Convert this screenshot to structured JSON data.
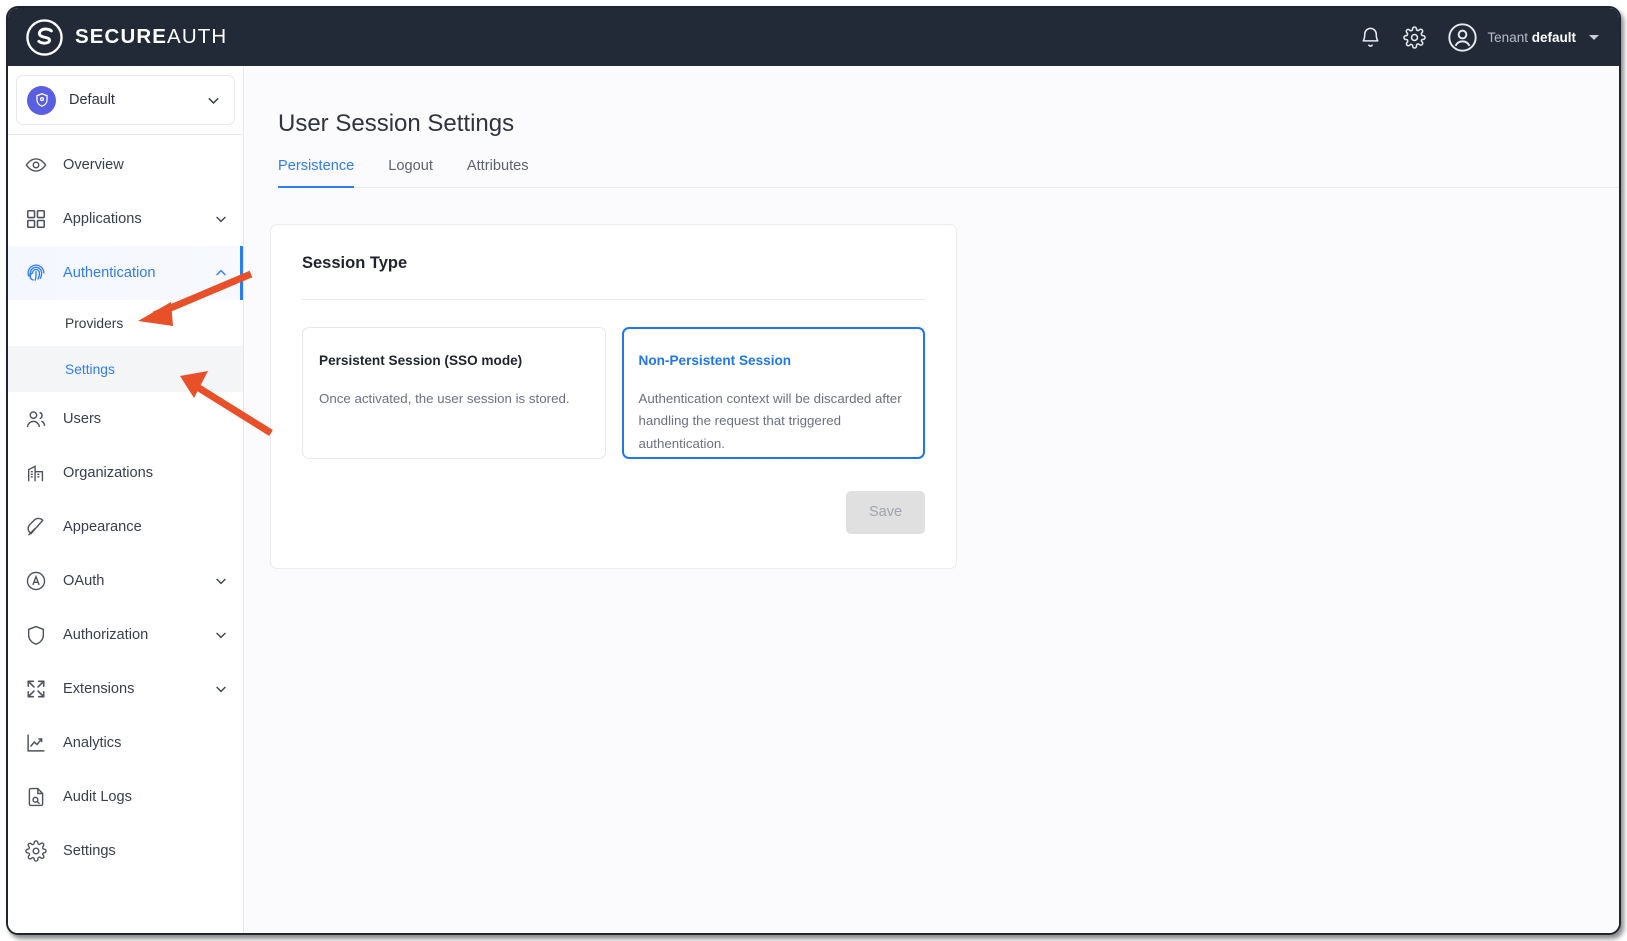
{
  "topbar": {
    "logo_bold": "SECURE",
    "logo_light": "AUTH",
    "logo_icon": "secureauth-s-logo",
    "bell_icon": "notification-bell-icon",
    "gear_icon": "gear-icon",
    "avatar_icon": "user-avatar-icon",
    "tenant_prefix": "Tenant",
    "tenant_name": "default",
    "background": "#222a38"
  },
  "sidebar": {
    "workspace": {
      "label": "Default",
      "icon": "shield-badge-icon",
      "badge_color": "#5a5ee0",
      "caret": "chevron-down-icon"
    },
    "items": [
      {
        "label": "Overview",
        "icon": "eye-icon",
        "expandable": false,
        "active": false
      },
      {
        "label": "Applications",
        "icon": "grid-squares-icon",
        "expandable": true,
        "active": false
      },
      {
        "label": "Authentication",
        "icon": "fingerprint-icon",
        "expandable": true,
        "active": true,
        "expanded": true
      },
      {
        "label": "Users",
        "icon": "users-icon",
        "expandable": false,
        "active": false
      },
      {
        "label": "Organizations",
        "icon": "building-icon",
        "expandable": false,
        "active": false
      },
      {
        "label": "Appearance",
        "icon": "feather-pen-icon",
        "expandable": false,
        "active": false
      },
      {
        "label": "OAuth",
        "icon": "circle-a-icon",
        "expandable": true,
        "active": false
      },
      {
        "label": "Authorization",
        "icon": "shield-icon",
        "expandable": true,
        "active": false
      },
      {
        "label": "Extensions",
        "icon": "expand-arrows-icon",
        "expandable": true,
        "active": false
      },
      {
        "label": "Analytics",
        "icon": "line-chart-icon",
        "expandable": false,
        "active": false
      },
      {
        "label": "Audit Logs",
        "icon": "document-search-icon",
        "expandable": false,
        "active": false
      },
      {
        "label": "Settings",
        "icon": "gear-icon",
        "expandable": false,
        "active": false
      }
    ],
    "authentication_subitems": [
      {
        "label": "Providers",
        "active": false
      },
      {
        "label": "Settings",
        "active": true
      }
    ],
    "active_color": "#2f7cf6",
    "active_bar_color": "#2b7df5"
  },
  "main": {
    "page_title": "User Session Settings",
    "tabs": [
      {
        "label": "Persistence",
        "active": true
      },
      {
        "label": "Logout",
        "active": false
      },
      {
        "label": "Attributes",
        "active": false
      }
    ],
    "panel": {
      "title": "Session Type",
      "options": [
        {
          "title": "Persistent Session (SSO mode)",
          "description": "Once activated, the user session is stored.",
          "selected": false
        },
        {
          "title": "Non-Persistent Session",
          "description": "Authentication context will be discarded after handling the request that triggered authentication.",
          "selected": true
        }
      ],
      "save_label": "Save",
      "save_disabled": true,
      "selected_border_color": "#2176f0"
    }
  },
  "annotations": {
    "arrow_color": "#e8502a",
    "arrows": [
      {
        "name": "arrow-to-providers",
        "points_to": "Providers"
      },
      {
        "name": "arrow-to-settings",
        "points_to": "Settings"
      }
    ]
  }
}
